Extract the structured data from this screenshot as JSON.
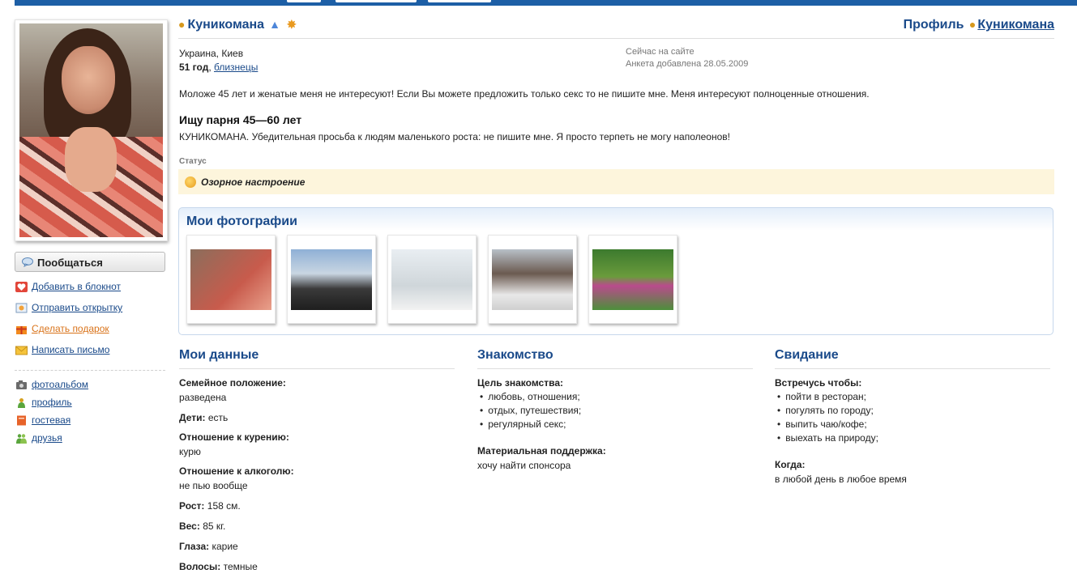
{
  "sidebar": {
    "talk_button": "Пообщаться",
    "actions": [
      {
        "label": "Добавить в блокнот",
        "icon": "heart-icon"
      },
      {
        "label": "Отправить открытку",
        "icon": "postcard-icon"
      },
      {
        "label": "Сделать подарок",
        "icon": "gift-icon"
      },
      {
        "label": "Написать письмо",
        "icon": "envelope-icon"
      }
    ],
    "links": [
      {
        "label": "фотоальбом",
        "icon": "camera-icon"
      },
      {
        "label": "профиль",
        "icon": "user-icon"
      },
      {
        "label": "гостевая",
        "icon": "book-icon"
      },
      {
        "label": "друзья",
        "icon": "friends-icon"
      }
    ]
  },
  "header": {
    "name": "Куникомана",
    "profile_label": "Профиль",
    "profile_name": "Куникомана"
  },
  "info": {
    "location": "Украина, Киев",
    "age": "51 год",
    "zodiac": "близнецы",
    "online": "Сейчас на сайте",
    "added": "Анкета добавлена 28.05.2009"
  },
  "about": "Моложе 45 лет и женатые меня не интересуют! Если Вы можете предложить только секс то не пишите мне. Меня интересуют полноценные отношения.",
  "seek_title": "Ищу парня 45—60 лет",
  "seek_text": "КУНИКОМАНА. Убедительная просьба к людям маленького роста: не пишите мне. Я просто терпеть не могу наполеонов!",
  "status": {
    "label": "Статус",
    "text": "Озорное настроение"
  },
  "photos": {
    "title": "Мои фотографии",
    "count": 5
  },
  "my_data": {
    "title": "Мои данные",
    "fields": [
      {
        "label": "Семейное положение:",
        "value": "разведена"
      },
      {
        "label": "Дети:",
        "value": "есть"
      },
      {
        "label": "Отношение к курению:",
        "value": "курю"
      },
      {
        "label": "Отношение к алкоголю:",
        "value": "не пью вообще"
      },
      {
        "label": "Рост:",
        "value": "158 см."
      },
      {
        "label": "Вес:",
        "value": "85 кг."
      },
      {
        "label": "Глаза:",
        "value": "карие"
      },
      {
        "label": "Волосы:",
        "value": "темные"
      }
    ]
  },
  "dating": {
    "title": "Знакомство",
    "goal_label": "Цель знакомства:",
    "goals": [
      "любовь, отношения;",
      "отдых, путешествия;",
      "регулярный секс;"
    ],
    "support_label": "Материальная поддержка:",
    "support_value": "хочу найти спонсора"
  },
  "date": {
    "title": "Свидание",
    "meet_label": "Встречусь чтобы:",
    "meet": [
      "пойти в ресторан;",
      "погулять по городу;",
      "выпить чаю/кофе;",
      "выехать на природу;"
    ],
    "when_label": "Когда:",
    "when_value": "в любой день в любое время"
  }
}
